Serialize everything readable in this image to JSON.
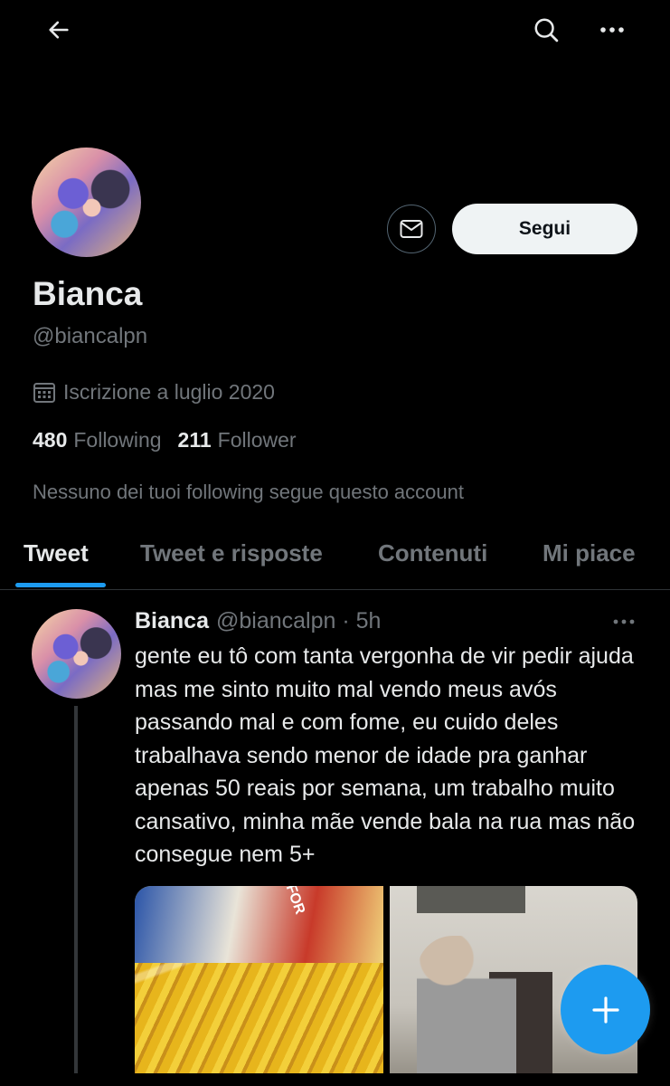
{
  "header": {
    "back_icon": "arrow-left-icon",
    "search_icon": "search-icon",
    "more_icon": "more-horizontal-icon"
  },
  "profile": {
    "name": "Bianca",
    "handle": "@biancalpn",
    "joined": "Iscrizione a luglio 2020",
    "following_count": "480",
    "following_label": "Following",
    "followers_count": "211",
    "followers_label": "Follower",
    "mutuals_note": "Nessuno dei tuoi following segue questo account",
    "follow_label": "Segui",
    "message_icon": "envelope-icon",
    "calendar_icon": "calendar-icon"
  },
  "tabs": [
    {
      "label": "Tweet",
      "active": true
    },
    {
      "label": "Tweet e risposte",
      "active": false
    },
    {
      "label": "Contenuti",
      "active": false
    },
    {
      "label": "Mi piace",
      "active": false
    }
  ],
  "tweet": {
    "name": "Bianca",
    "meta": "@biancalpn · 5h",
    "text": "gente eu tô com tanta vergonha de vir pedir ajuda mas me sinto muito mal vendo meus avós passando mal e com fome, eu cuido deles trabalhava sendo menor de idade pra ganhar apenas 50 reais por semana, um trabalho muito cansativo, minha mãe vende bala na rua mas não consegue nem 5+",
    "media_1_label": "FOR",
    "more_icon": "more-horizontal-icon"
  },
  "fab": {
    "icon": "plus-icon",
    "color": "#1d9bf0"
  }
}
